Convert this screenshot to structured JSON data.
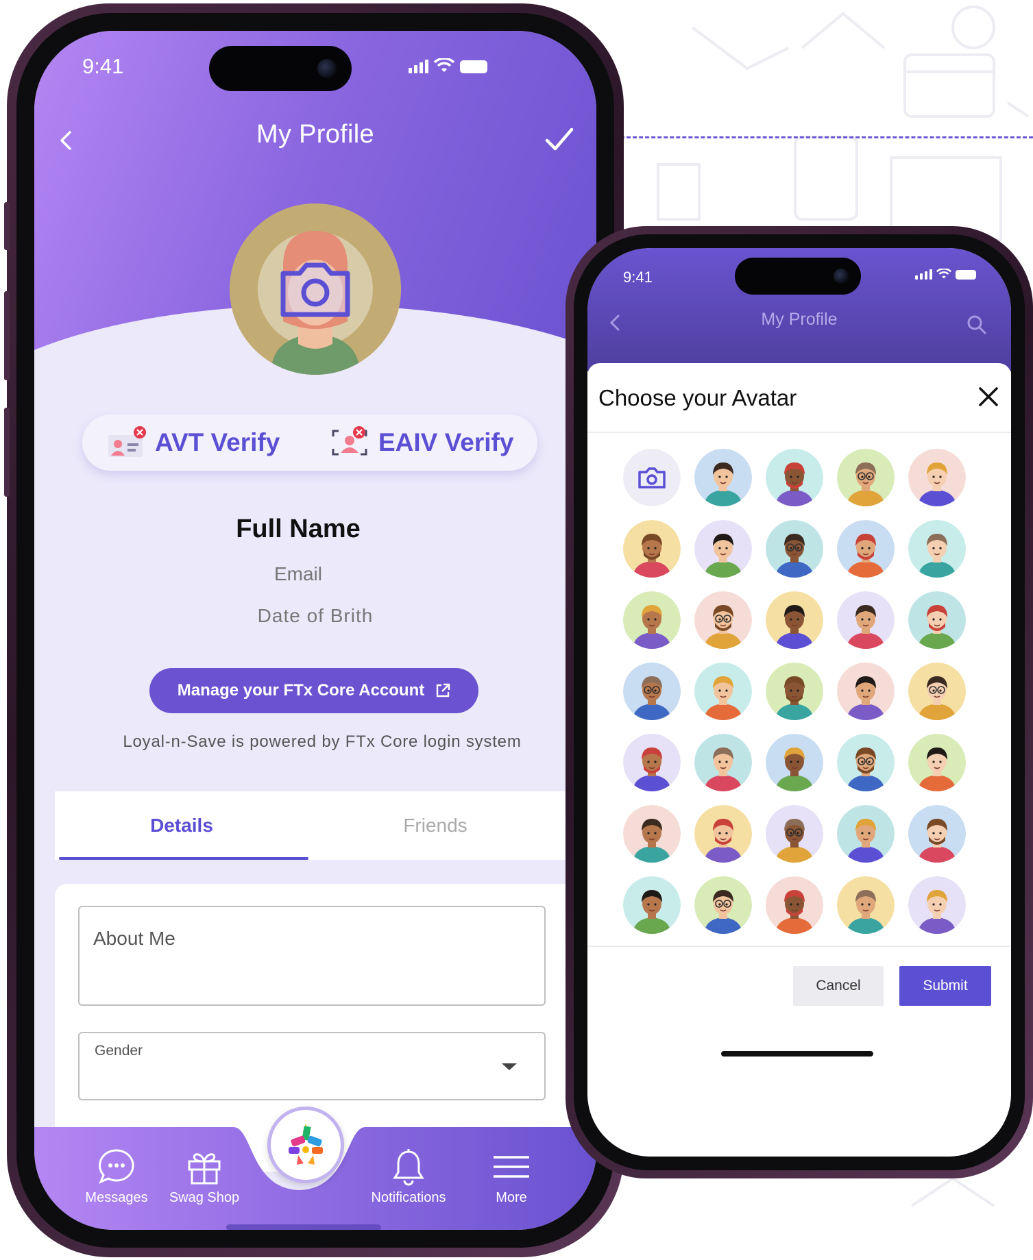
{
  "phone_main": {
    "status": {
      "time": "9:41"
    },
    "header": {
      "title": "My Profile",
      "back_icon": "chevron-left-icon",
      "confirm_icon": "checkmark-icon"
    },
    "avatar": {
      "overlay_icon": "camera-icon"
    },
    "verify": [
      {
        "label": "AVT Verify",
        "icon": "id-card-verify-icon",
        "status_color": "#e53950"
      },
      {
        "label": "EAIV Verify",
        "icon": "face-scan-verify-icon",
        "status_color": "#e53950"
      }
    ],
    "profile": {
      "name": "Full Name",
      "email": "Email",
      "dob": "Date of Brith"
    },
    "manage_button": {
      "label": "Manage your FTx Core Account",
      "icon": "external-link-icon"
    },
    "powered_text": "Loyal-n-Save is powered by FTx Core login system",
    "tabs": [
      {
        "label": "Details",
        "active": true
      },
      {
        "label": "Friends",
        "active": false
      }
    ],
    "form": {
      "about_placeholder": "About Me",
      "gender_label": "Gender"
    },
    "nav": [
      {
        "label": "Messages",
        "icon": "chat-bubble-icon"
      },
      {
        "label": "Swag Shop",
        "icon": "gift-icon"
      },
      {
        "label": "Notifications",
        "icon": "bell-icon"
      },
      {
        "label": "More",
        "icon": "menu-icon"
      }
    ]
  },
  "phone_avatar": {
    "status": {
      "time": "9:41"
    },
    "header": {
      "title": "My Profile"
    },
    "sheet": {
      "title": "Choose your Avatar",
      "cancel_label": "Cancel",
      "submit_label": "Submit"
    }
  },
  "colors": {
    "accent": "#5b4fd4",
    "header_gradient_start": "#b486f3",
    "header_gradient_end": "#6a52d0",
    "error_badge": "#e53950"
  }
}
